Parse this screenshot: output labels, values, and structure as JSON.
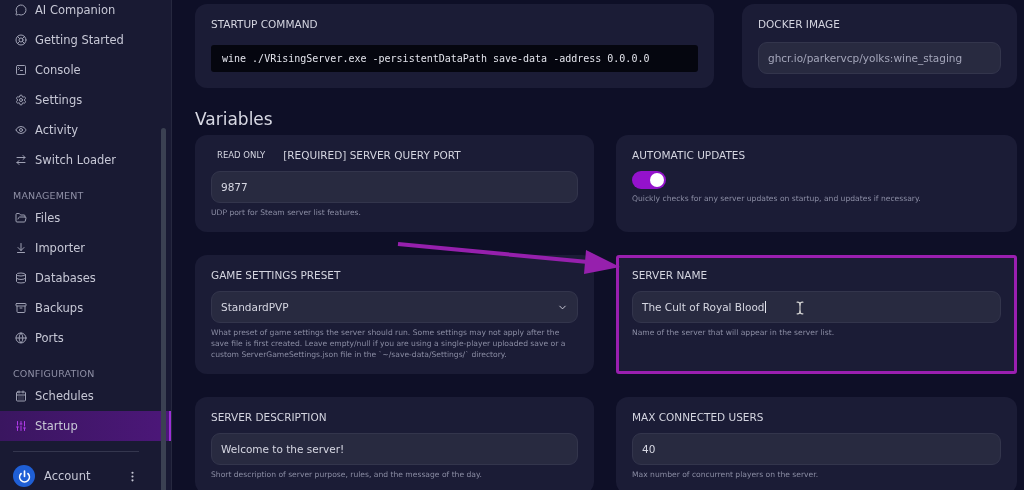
{
  "sidebar": {
    "sections": [
      {
        "items": [
          {
            "label": "AI Companion",
            "selected": false
          },
          {
            "label": "Getting Started",
            "selected": false
          },
          {
            "label": "Console",
            "selected": false
          },
          {
            "label": "Settings",
            "selected": false
          },
          {
            "label": "Activity",
            "selected": false
          },
          {
            "label": "Switch Loader",
            "selected": false
          }
        ]
      },
      {
        "heading": "MANAGEMENT",
        "items": [
          {
            "label": "Files",
            "selected": false
          },
          {
            "label": "Importer",
            "selected": false
          },
          {
            "label": "Databases",
            "selected": false
          },
          {
            "label": "Backups",
            "selected": false
          },
          {
            "label": "Ports",
            "selected": false
          }
        ]
      },
      {
        "heading": "CONFIGURATION",
        "items": [
          {
            "label": "Schedules",
            "selected": false
          },
          {
            "label": "Startup",
            "selected": true
          }
        ]
      }
    ],
    "account": {
      "label": "Account"
    }
  },
  "startup_command": {
    "label": "STARTUP COMMAND",
    "value": "wine ./VRisingServer.exe -persistentDataPath save-data -address 0.0.0.0"
  },
  "docker_image": {
    "label": "DOCKER IMAGE",
    "value": "ghcr.io/parkervcp/yolks:wine_staging"
  },
  "variables_heading": "Variables",
  "variables": [
    {
      "kind": "text",
      "badge": "READ ONLY",
      "label": "[REQUIRED] SERVER QUERY PORT",
      "value": "9877",
      "description": "UDP port for Steam server list features.",
      "highlighted": false
    },
    {
      "kind": "toggle",
      "label": "AUTOMATIC UPDATES",
      "on": true,
      "description": "Quickly checks for any server updates on startup, and updates if necessary.",
      "highlighted": false
    },
    {
      "kind": "select",
      "label": "GAME SETTINGS PRESET",
      "value": "StandardPVP",
      "description": "What preset of game settings the server should run. Some settings may not apply after the save file is first created. Leave empty/null if you are using a single-player uploaded save or a custom ServerGameSettings.json file in the `~/save-data/Settings/` directory.",
      "highlighted": false
    },
    {
      "kind": "text",
      "label": "SERVER NAME",
      "value": "The Cult of Royal Blood",
      "description": "Name of the server that will appear in the server list.",
      "highlighted": true
    },
    {
      "kind": "text",
      "label": "SERVER DESCRIPTION",
      "value": "Welcome to the server!",
      "description": "Short description of server purpose, rules, and the message of the day.",
      "highlighted": false
    },
    {
      "kind": "text",
      "label": "MAX CONNECTED USERS",
      "value": "40",
      "description": "Max number of concurrent players on the server.",
      "highlighted": false
    }
  ]
}
